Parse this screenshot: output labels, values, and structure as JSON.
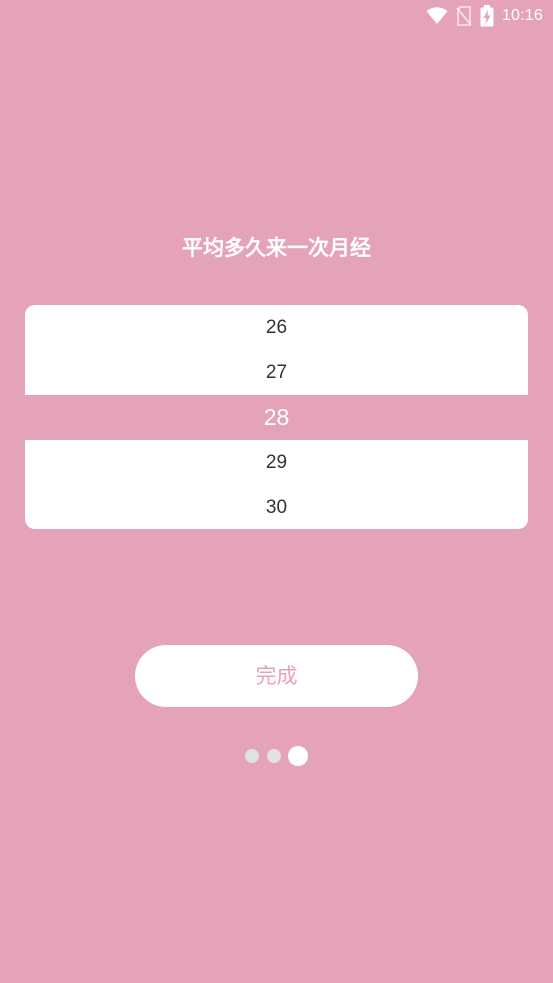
{
  "status_bar": {
    "time": "10:16",
    "icons": [
      "wifi-icon",
      "no-sim-icon",
      "battery-charging-icon"
    ]
  },
  "title": "平均多久来一次月经",
  "picker": {
    "items": [
      "26",
      "27",
      "28",
      "29",
      "30"
    ],
    "selected_value": "28"
  },
  "done_button": {
    "label": "完成"
  },
  "page_indicator": {
    "total": 3,
    "current": 3
  },
  "colors": {
    "background": "#e4a3b6",
    "accent": "#e4a3b6",
    "panel": "#ffffff",
    "text_dark": "#333333",
    "dot_inactive": "#e2e2e2",
    "dot_active": "#ffffff"
  }
}
